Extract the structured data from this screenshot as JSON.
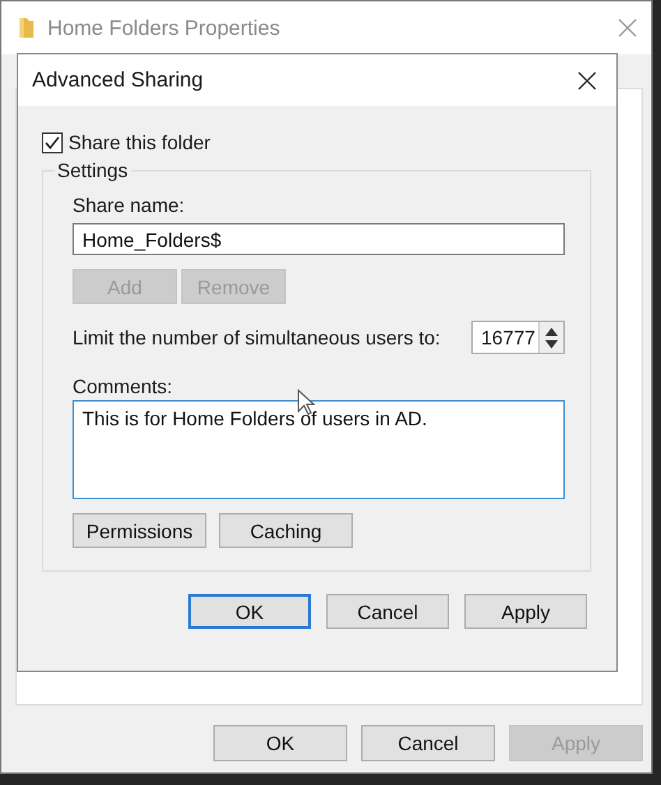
{
  "background_window": {
    "title": "Home Folders Properties",
    "buttons": [
      {
        "label": "OK",
        "disabled": false
      },
      {
        "label": "Cancel",
        "disabled": false
      },
      {
        "label": "Apply",
        "disabled": true
      }
    ]
  },
  "dialog": {
    "title": "Advanced Sharing",
    "share_checkbox": {
      "label": "Share this folder",
      "checked": true
    },
    "settings": {
      "title": "Settings",
      "share_name_label": "Share name:",
      "share_name": "Home_Folders$",
      "name_buttons": [
        {
          "label": "Add",
          "disabled": true
        },
        {
          "label": "Remove",
          "disabled": true
        }
      ],
      "limit_label": "Limit the number of simultaneous users to:",
      "limit_value": "16777",
      "comments_label": "Comments:",
      "comments": "This is for Home Folders of users in AD.",
      "extra_buttons": [
        {
          "label": "Permissions",
          "disabled": false
        },
        {
          "label": "Caching",
          "disabled": false
        }
      ]
    },
    "buttons": [
      {
        "label": "OK",
        "focused": true
      },
      {
        "label": "Cancel",
        "focused": false
      },
      {
        "label": "Apply",
        "focused": false
      }
    ]
  }
}
